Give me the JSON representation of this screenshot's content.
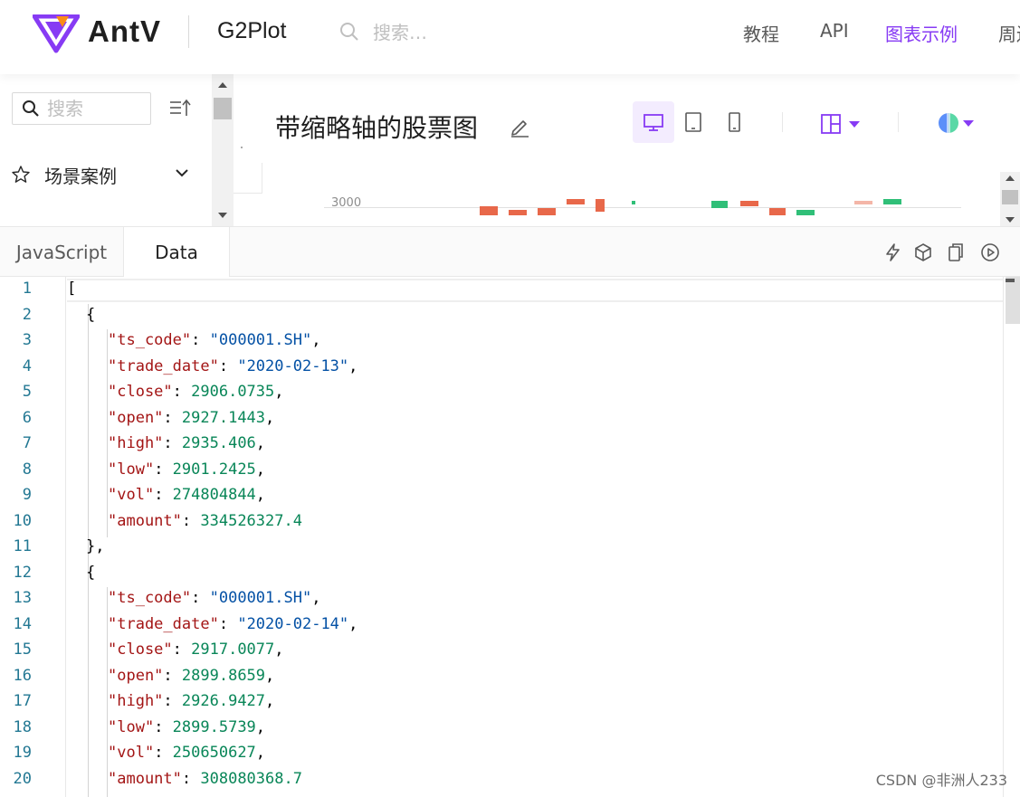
{
  "header": {
    "brand": "AntV",
    "product": "G2Plot",
    "search_placeholder": "搜索…",
    "nav": [
      {
        "label": "教程",
        "active": false
      },
      {
        "label": "API",
        "active": false
      },
      {
        "label": "图表示例",
        "active": true
      },
      {
        "label": "周边",
        "active": false
      }
    ],
    "accent_color": "#873bf4"
  },
  "sidebar": {
    "search_placeholder": "搜索",
    "items": [
      {
        "label": "场景案例",
        "icon": "star-icon",
        "expand_icon": "chevron-down-icon"
      }
    ]
  },
  "preview": {
    "title": "带缩略轴的股票图",
    "devices": [
      "desktop-icon",
      "tablet-icon",
      "mobile-icon"
    ],
    "active_device": "desktop-icon",
    "chart_axis_label": "3000"
  },
  "editor": {
    "tabs": [
      {
        "label": "JavaScript",
        "active": false
      },
      {
        "label": "Data",
        "active": true
      }
    ],
    "toolbar_icons": [
      "lightning-icon",
      "codesandbox-icon",
      "copy-icon",
      "play-icon"
    ],
    "line_numbers": [
      "1",
      "2",
      "3",
      "4",
      "5",
      "6",
      "7",
      "8",
      "9",
      "10",
      "11",
      "12",
      "13",
      "14",
      "15",
      "16",
      "17",
      "18",
      "19",
      "20"
    ],
    "records": [
      {
        "ts_code": "000001.SH",
        "trade_date": "2020-02-13",
        "close": "2906.0735",
        "open": "2927.1443",
        "high": "2935.406",
        "low": "2901.2425",
        "vol": "274804844",
        "amount": "334526327.4"
      },
      {
        "ts_code": "000001.SH",
        "trade_date": "2020-02-14",
        "close": "2917.0077",
        "open": "2899.8659",
        "high": "2926.9427",
        "low": "2899.5739",
        "vol": "250650627",
        "amount": "308080368.7"
      }
    ]
  },
  "watermark": "CSDN @非洲人233"
}
